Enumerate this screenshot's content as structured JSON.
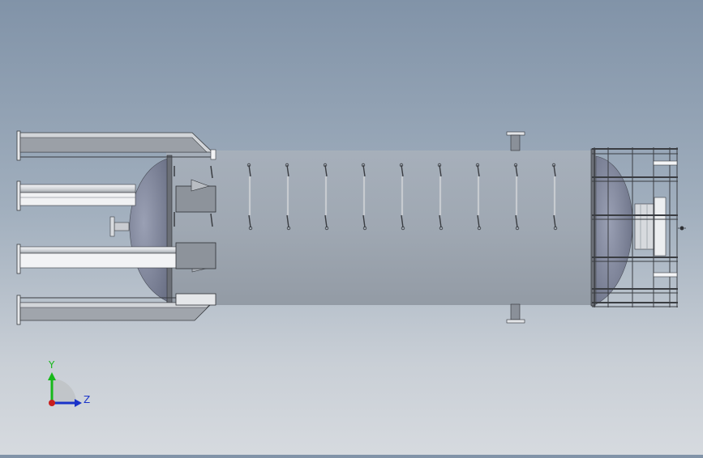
{
  "view": {
    "background_top": "#8193a8",
    "background_bottom": "#d6dadf"
  },
  "triad": {
    "y_label": "Y",
    "z_label": "Z",
    "y_color": "#17b81a",
    "z_color": "#1a33c9",
    "origin_color": "#c81e1e"
  },
  "model": {
    "body_color": "#9aa3af",
    "shade_color": "#7e8794",
    "steel_color": "#c8cbd0",
    "dark_color": "#3a3d42",
    "clip_count": 9
  }
}
